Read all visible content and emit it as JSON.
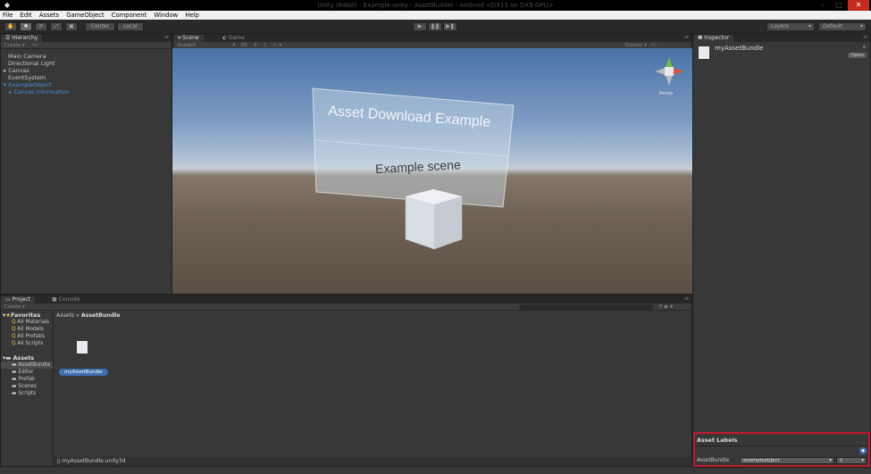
{
  "window": {
    "title": "Unity (64bit) - Example.unity - AssetBuilder - Android <DX11 on DX9 GPU>"
  },
  "menu": [
    "File",
    "Edit",
    "Assets",
    "GameObject",
    "Component",
    "Window",
    "Help"
  ],
  "toolbar": {
    "pivot_label": "Center",
    "space_label": "Local",
    "layers_label": "Layers",
    "layout_label": "Default"
  },
  "hierarchy": {
    "tab": "Hierarchy",
    "create_label": "Create",
    "search_placeholder": "All",
    "items": [
      {
        "label": "Main Camera"
      },
      {
        "label": "Directional Light"
      },
      {
        "label": "Canvas"
      },
      {
        "label": "EventSystem"
      },
      {
        "label": "ExampleObject"
      },
      {
        "label": "Canvas Information"
      }
    ]
  },
  "scene": {
    "tab_scene": "Scene",
    "tab_game": "Game",
    "shading": "Shaded",
    "mode_2d": "2D",
    "gizmos_label": "Gizmos",
    "gizmos_search": "All",
    "persp_label": "Persp",
    "banner_title": "Asset Download Example",
    "banner_subtitle": "Example scene"
  },
  "project": {
    "tab": "Project",
    "console_tab": "Console",
    "create_label": "Create",
    "breadcrumb_root": "Assets",
    "breadcrumb_sep": "»",
    "breadcrumb_current": "AssetBundle",
    "favorites_label": "Favorites",
    "favorites": [
      "All Materials",
      "All Models",
      "All Prefabs",
      "All Scripts"
    ],
    "assets_label": "Assets",
    "folders": [
      "AssetBundle",
      "Editor",
      "Prefab",
      "Scenes",
      "Scripts"
    ],
    "selected_asset": "myAssetBundle",
    "status_path": "myAssetBundle.unity3d"
  },
  "inspector": {
    "tab": "Inspector",
    "asset_name": "myAssetBundle",
    "open_label": "Open",
    "asset_labels_title": "Asset Labels",
    "bundle_field_label": "AssetBundle",
    "bundle_value": "exampleobject",
    "variant_value": "1"
  },
  "colors": {
    "highlight_border": "#c0192d",
    "selection_blue": "#3c6fb0",
    "link_blue": "#4d8ed6"
  }
}
